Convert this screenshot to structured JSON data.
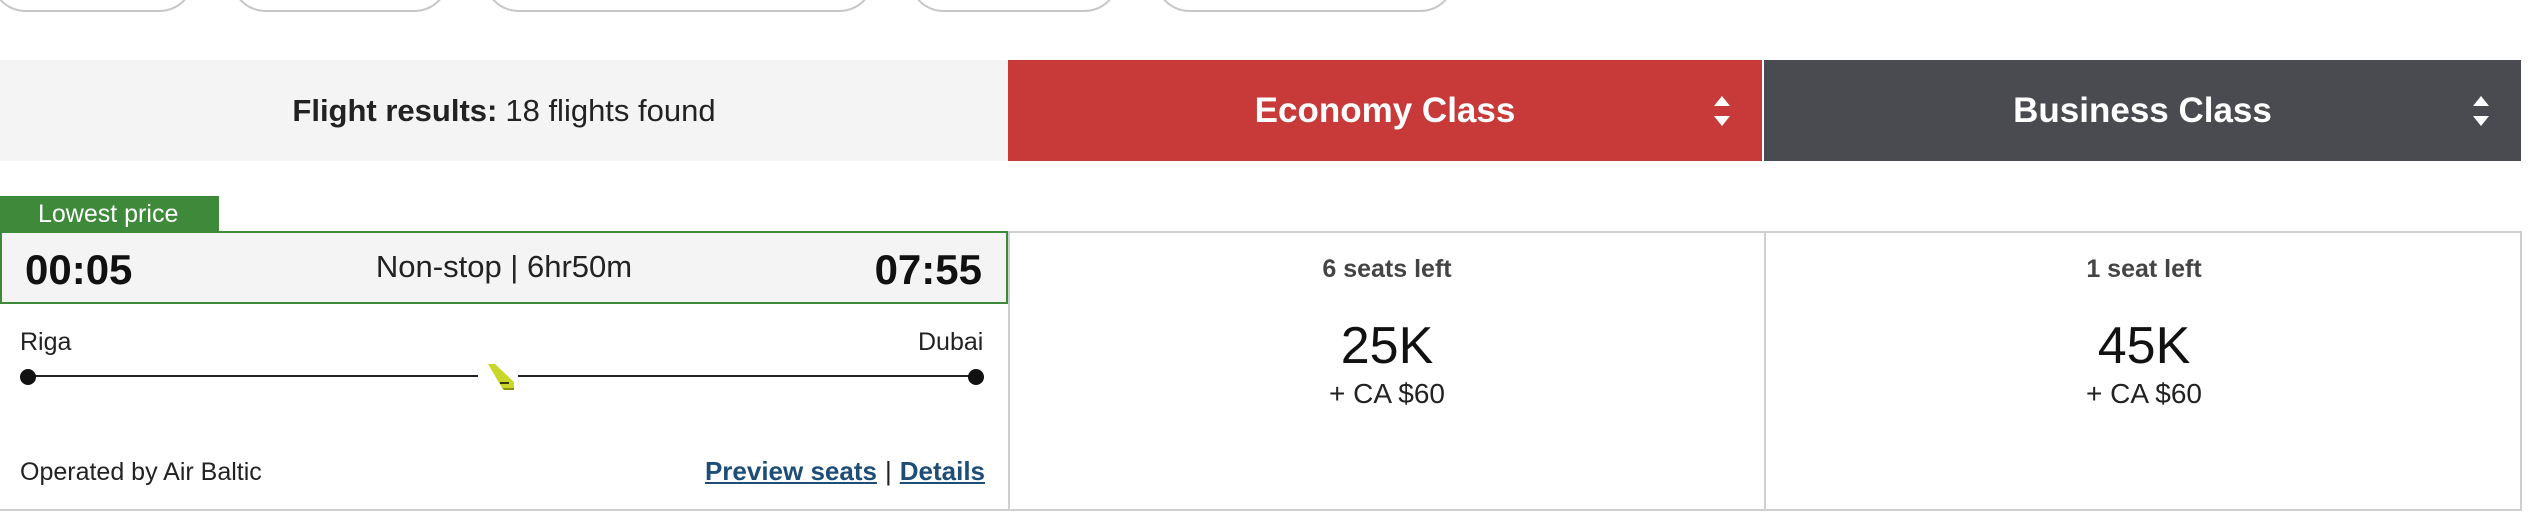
{
  "results": {
    "label": "Flight results:",
    "count_text": "18 flights found"
  },
  "cabins": {
    "economy": "Economy Class",
    "business": "Business Class"
  },
  "flight": {
    "badge": "Lowest price",
    "departure_time": "00:05",
    "arrival_time": "07:55",
    "duration": "Non-stop | 6hr50m",
    "origin": "Riga",
    "destination": "Dubai",
    "operator": "Operated by Air Baltic",
    "preview_seats": "Preview seats",
    "separator": "|",
    "details": "Details",
    "fares": [
      {
        "seats_left": "6 seats left",
        "points": "25K",
        "cash": "+ CA $60"
      },
      {
        "seats_left": "1 seat left",
        "points": "45K",
        "cash": "+ CA $60"
      }
    ]
  },
  "colors": {
    "economy": "#c83a3a",
    "business": "#4a4b50",
    "lowest_price": "#3f8a3a",
    "link": "#1e4d78",
    "plane": "#c9d62a"
  },
  "icons": {
    "sort": "sort-arrows-icon",
    "plane": "airplane-icon"
  }
}
